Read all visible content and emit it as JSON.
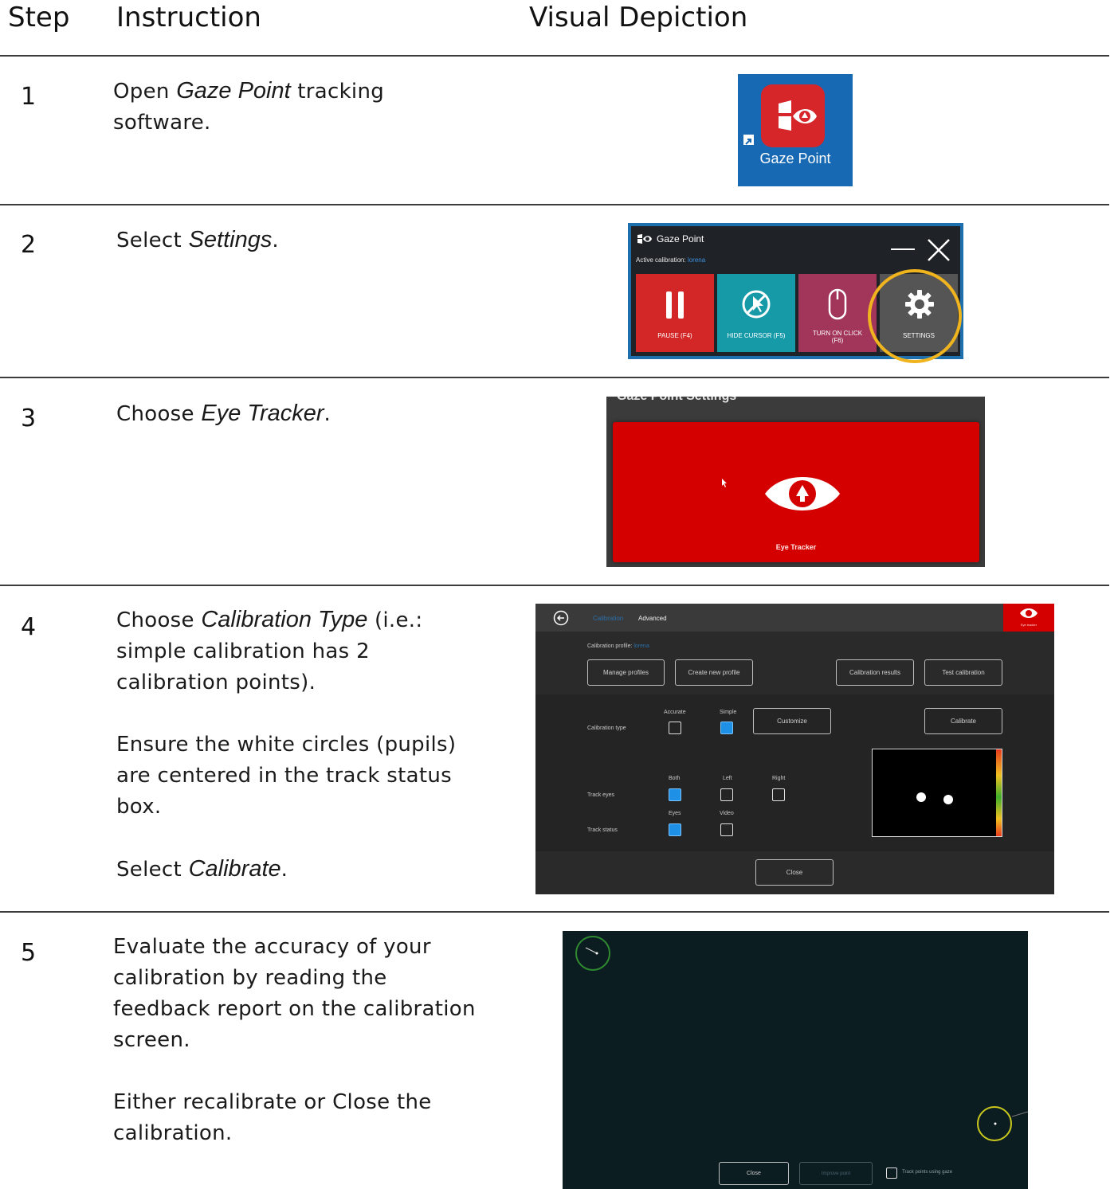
{
  "header": {
    "step": "Step",
    "instruction": "Instruction",
    "visual": "Visual Depiction"
  },
  "steps": [
    {
      "number": "1",
      "text_a": "Open ",
      "em_a": "Gaze Point",
      "text_b": " tracking",
      "text_c": "software.",
      "visual": {
        "icon_label": "Gaze Point",
        "bg": "#1769b3",
        "tile": "#d6262a"
      }
    },
    {
      "number": "2",
      "text_a": "Select ",
      "em_a": "Settings",
      "text_b": ".",
      "visual": {
        "title": "Gaze Point",
        "active_label": "Active calibration:",
        "active_value": "lorena",
        "buttons": [
          {
            "label": "PAUSE (F4)",
            "color": "#d32626"
          },
          {
            "label": "HIDE CURSOR (F5)",
            "color": "#169aa8"
          },
          {
            "label": "TURN ON CLICK",
            "label2": "(F6)",
            "color": "#a2355a"
          },
          {
            "label": "SETTINGS",
            "color": "#555555"
          }
        ],
        "highlight": "#f0b41e"
      }
    },
    {
      "number": "3",
      "text_a": "Choose ",
      "em_a": "Eye Tracker",
      "text_b": ".",
      "visual": {
        "title": "Gaze Point Settings",
        "tile_label": "Eye Tracker",
        "tile": "#d40000"
      }
    },
    {
      "number": "4",
      "line1_a": "Choose ",
      "line1_em": "Calibration Type",
      "line1_b": " (i.e.:",
      "line2": "simple calibration has 2",
      "line3": "calibration points).",
      "line4": "Ensure the white circles (pupils)",
      "line5": "are centered in the track status",
      "line6": "box.",
      "line7_a": "Select ",
      "line7_em": "Calibrate",
      "line7_b": ".",
      "visual": {
        "tab_active": "Calibration",
        "tab_other": "Advanced",
        "corner_label": "Eye tracker",
        "profile_label": "Calibration profile:",
        "profile_value": "lorena",
        "btn_manage": "Manage profiles",
        "btn_create": "Create new profile",
        "btn_results": "Calibration results",
        "btn_test": "Test calibration",
        "lbl_accurate": "Accurate",
        "lbl_simple": "Simple",
        "btn_customize": "Customize",
        "btn_calibrate": "Calibrate",
        "lbl_cal_type": "Calibration type",
        "lbl_both": "Both",
        "lbl_left": "Left",
        "lbl_right": "Right",
        "lbl_track_eyes": "Track eyes",
        "lbl_eyes": "Eyes",
        "lbl_video": "Video",
        "lbl_track_status": "Track status",
        "btn_close": "Close"
      }
    },
    {
      "number": "5",
      "line1": "Evaluate the accuracy of your",
      "line2": "calibration by reading the",
      "line3": "feedback report on the calibration",
      "line4": "screen.",
      "line5": "Either recalibrate or Close the",
      "line6": "calibration.",
      "visual": {
        "btn_close": "Close",
        "btn_improve": "Improve point",
        "chk_label": "Track points using gaze"
      }
    }
  ]
}
